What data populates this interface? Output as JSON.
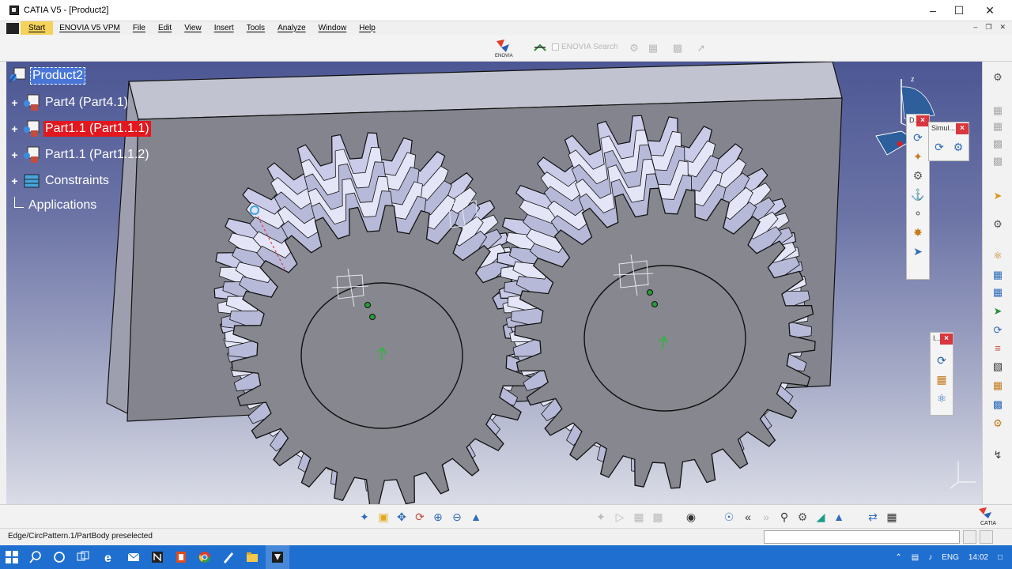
{
  "window": {
    "title": "CATIA V5 - [Product2]"
  },
  "menu": {
    "items": [
      "Start",
      "ENOVIA V5 VPM",
      "File",
      "Edit",
      "View",
      "Insert",
      "Tools",
      "Analyze",
      "Window",
      "Help"
    ]
  },
  "top_toolbar": {
    "search_label": "ENOVIA Search"
  },
  "tree": {
    "root": "Product2",
    "nodes": [
      {
        "label": "Part4 (Part4.1)"
      },
      {
        "label": "Part1.1 (Part1.1.1)"
      },
      {
        "label": "Part1.1 (Part1.1.2)"
      },
      {
        "label": "Constraints"
      },
      {
        "label": "Applications"
      }
    ]
  },
  "compass": {
    "axis_z": "z"
  },
  "floating_toolbars": {
    "first_title": "D...",
    "second_title": "Simul...",
    "third_title": "I..."
  },
  "status": {
    "message": "Edge/CircPattern.1/PartBody preselected",
    "command_value": ""
  },
  "taskbar": {
    "language": "ENG",
    "time": "14:02"
  },
  "colors": {
    "viewport_top": "#4c5794",
    "viewport_bottom": "#dadce6",
    "selection_red": "#e3181e",
    "start_yellow": "#f4d25c",
    "taskbar_blue": "#1f6fd0"
  }
}
